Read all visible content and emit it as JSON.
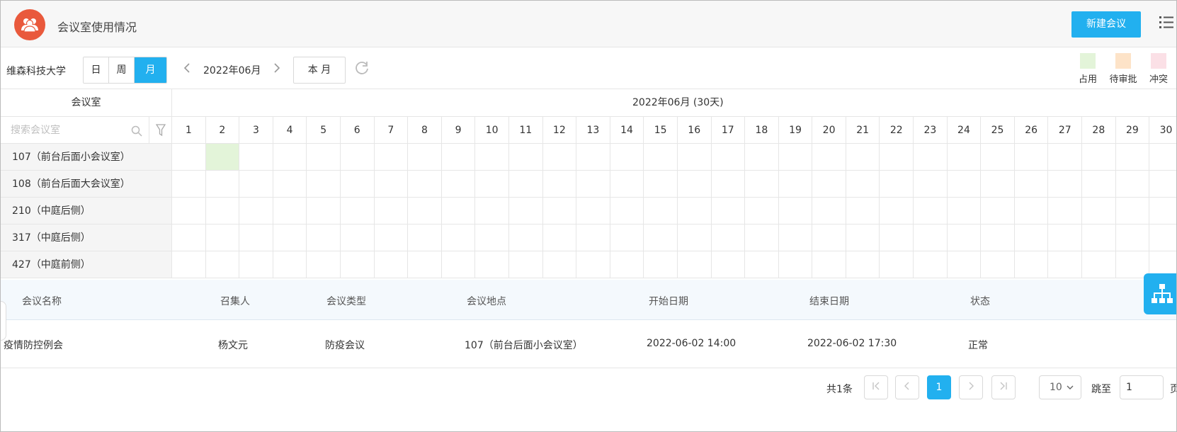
{
  "header": {
    "title": "会议室使用情况",
    "new_button": "新建会议"
  },
  "toolbar": {
    "org": "维森科技大学",
    "views": [
      "日",
      "周",
      "月"
    ],
    "active_view": "月",
    "current_month": "2022年06月",
    "this_month": "本 月",
    "legend": [
      {
        "label": "占用",
        "color": "#e3f4d9"
      },
      {
        "label": "待审批",
        "color": "#fde3c8"
      },
      {
        "label": "冲突",
        "color": "#fbe0e6"
      }
    ]
  },
  "calendar": {
    "room_header": "会议室",
    "month_header": "2022年06月 (30天)",
    "search_placeholder": "搜索会议室",
    "days": [
      "1",
      "2",
      "3",
      "4",
      "5",
      "6",
      "7",
      "8",
      "9",
      "10",
      "11",
      "12",
      "13",
      "14",
      "15",
      "16",
      "17",
      "18",
      "19",
      "20",
      "21",
      "22",
      "23",
      "24",
      "25",
      "26",
      "27",
      "28",
      "29",
      "30"
    ],
    "rooms": [
      "107（前台后面小会议室）",
      "108（前台后面大会议室）",
      "210（中庭后侧）",
      "317（中庭后侧）",
      "427（中庭前侧）"
    ],
    "occupied": [
      {
        "room": 0,
        "day": 2
      }
    ]
  },
  "list": {
    "columns": [
      "会议名称",
      "召集人",
      "会议类型",
      "会议地点",
      "开始日期",
      "结束日期",
      "状态"
    ],
    "rows": [
      [
        "疫情防控例会",
        "杨文元",
        "防疫会议",
        "107（前台后面小会议室）",
        "2022-06-02 14:00",
        "2022-06-02 17:30",
        "正常"
      ]
    ]
  },
  "pager": {
    "total": "共1条",
    "current_page": "1",
    "page_size": "10",
    "jump_label": "跳至",
    "jump_value": "1",
    "page_unit": "页"
  }
}
